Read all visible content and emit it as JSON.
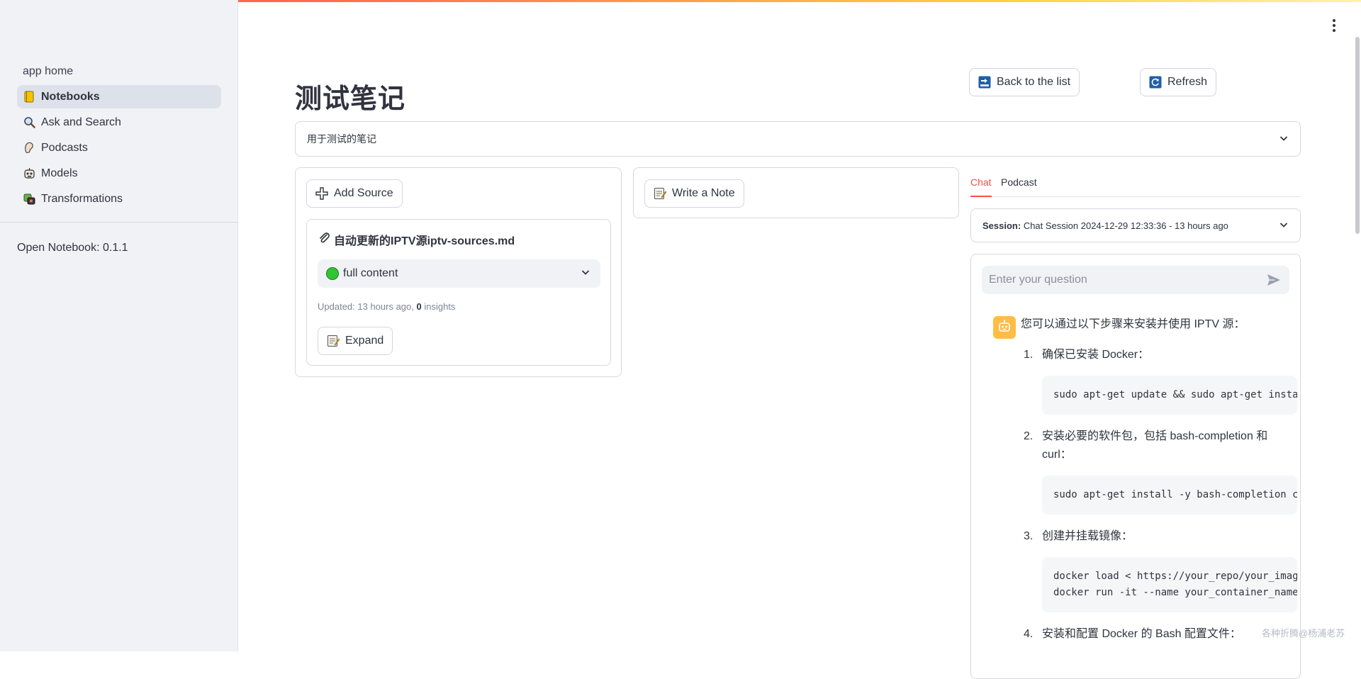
{
  "sidebar": {
    "items": [
      {
        "label": "app home",
        "icon": ""
      },
      {
        "label": "Notebooks",
        "icon": "notebook-icon",
        "active": true
      },
      {
        "label": "Ask and Search",
        "icon": "magnifier-icon"
      },
      {
        "label": "Podcasts",
        "icon": "podcast-icon"
      },
      {
        "label": "Models",
        "icon": "robot-face-icon"
      },
      {
        "label": "Transformations",
        "icon": "transform-icon"
      }
    ],
    "version": "Open Notebook: 0.1.1"
  },
  "header": {
    "title": "测试笔记",
    "back_label": "Back to the list",
    "refresh_label": "Refresh"
  },
  "description": {
    "text": "用于测试的笔记"
  },
  "sources": {
    "add_label": "Add Source",
    "items": [
      {
        "title": "自动更新的IPTV源iptv-sources.md",
        "context": "full content",
        "meta_prefix": "Updated: 13 hours ago, ",
        "insights_count": "0",
        "meta_suffix": " insights",
        "expand_label": "Expand"
      }
    ]
  },
  "notes": {
    "write_label": "Write a Note"
  },
  "chat": {
    "tabs": [
      {
        "label": "Chat",
        "active": true
      },
      {
        "label": "Podcast"
      }
    ],
    "session_label": "Session:",
    "session_value": "Chat Session 2024-12-29 12:33:36 - 13 hours ago",
    "input_placeholder": "Enter your question",
    "message": {
      "intro": "您可以通过以下步骤来安装并使用 IPTV 源：",
      "steps": [
        {
          "num": "1.",
          "text": "确保已安装 Docker：",
          "code": "sudo apt-get update && sudo apt-get install docker.io"
        },
        {
          "num": "2.",
          "text": "安装必要的软件包，包括 bash-completion 和 curl：",
          "code": "sudo apt-get install -y bash-completion curl"
        },
        {
          "num": "3.",
          "text": "创建并挂载镜像：",
          "code": "docker load < https://your_repo/your_image.tar\ndocker run -it --name your_container_name your_image"
        },
        {
          "num": "4.",
          "text": "安装和配置 Docker 的 Bash 配置文件："
        }
      ]
    }
  },
  "watermark": "各种折腾@杨浦老苏",
  "colors": {
    "accent": "#ff4b4b",
    "sidebar_bg": "#f0f2f6",
    "status_green": "#2fc434",
    "bot_avatar": "#ffbd45"
  }
}
